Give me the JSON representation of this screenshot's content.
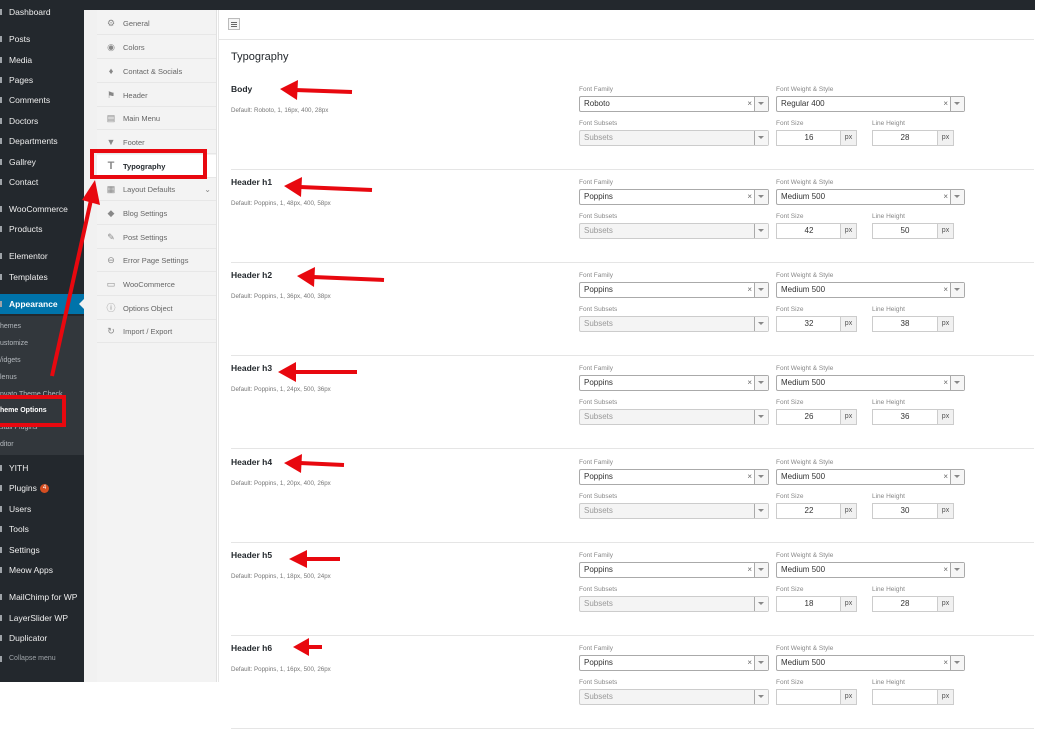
{
  "wp_menu": {
    "dashboard": "Dashboard",
    "posts": "Posts",
    "media": "Media",
    "pages": "Pages",
    "comments": "Comments",
    "doctors": "Doctors",
    "departments": "Departments",
    "gallery": "Gallrey",
    "contact": "Contact",
    "woocommerce": "WooCommerce",
    "products": "Products",
    "elementor": "Elementor",
    "templates": "Templates",
    "appearance": "Appearance",
    "sub_themes": "hemes",
    "sub_customize": "ustomize",
    "sub_widgets": "/idgets",
    "sub_menus": "lenus",
    "sub_envato": "nvato Theme Check",
    "sub_theme_options": "heme Options",
    "sub_install_plugins": "stall Plugins",
    "sub_editor": "ditor",
    "yith": "YITH",
    "plugins": "Plugins",
    "plugins_badge": "4",
    "users": "Users",
    "tools": "Tools",
    "settings": "Settings",
    "meow_apps": "Meow Apps",
    "mailchimp": "MailChimp for WP",
    "layerslider": "LayerSlider WP",
    "duplicator": "Duplicator",
    "collapse": "Collapse menu"
  },
  "options_nav": {
    "general": "General",
    "colors": "Colors",
    "contact_social": "Contact & Socials",
    "header": "Header",
    "main_menu": "Main Menu",
    "footer": "Footer",
    "typography": "Typography",
    "layout_defaults": "Layout Defaults",
    "blog_settings": "Blog Settings",
    "post_settings": "Post Settings",
    "error_page": "Error Page Settings",
    "woocommerce": "WooCommerce",
    "options_object": "Options Object",
    "import_export": "Import / Export"
  },
  "section_title": "Typography",
  "labels": {
    "font_family": "Font Family",
    "font_weight_style": "Font Weight & Style",
    "font_subsets": "Font Subsets",
    "font_size": "Font Size",
    "line_height": "Line Height",
    "subsets_placeholder": "Subsets",
    "px_unit": "px",
    "clear": "×"
  },
  "rows": [
    {
      "title": "Body",
      "default": "Default: Roboto, 1, 16px, 400, 28px",
      "family": "Roboto",
      "weight": "Regular 400",
      "size": "16",
      "line_height": "28"
    },
    {
      "title": "Header h1",
      "default": "Default: Poppins, 1, 48px, 400, 58px",
      "family": "Poppins",
      "weight": "Medium 500",
      "size": "42",
      "line_height": "50"
    },
    {
      "title": "Header h2",
      "default": "Default: Poppins, 1, 36px, 400, 38px",
      "family": "Poppins",
      "weight": "Medium 500",
      "size": "32",
      "line_height": "38"
    },
    {
      "title": "Header h3",
      "default": "Default: Poppins, 1, 24px, 500, 36px",
      "family": "Poppins",
      "weight": "Medium 500",
      "size": "26",
      "line_height": "36"
    },
    {
      "title": "Header h4",
      "default": "Default: Poppins, 1, 20px, 400, 26px",
      "family": "Poppins",
      "weight": "Medium 500",
      "size": "22",
      "line_height": "30"
    },
    {
      "title": "Header h5",
      "default": "Default: Poppins, 1, 18px, 500, 24px",
      "family": "Poppins",
      "weight": "Medium 500",
      "size": "18",
      "line_height": "28"
    },
    {
      "title": "Header h6",
      "default": "Default: Poppins, 1, 16px, 500, 26px",
      "family": "Poppins",
      "weight": "Medium 500",
      "size": "",
      "line_height": ""
    }
  ],
  "colors": {
    "accent": "#0073aa",
    "annotation": "#e8080f",
    "admin_bar": "#23282d"
  }
}
